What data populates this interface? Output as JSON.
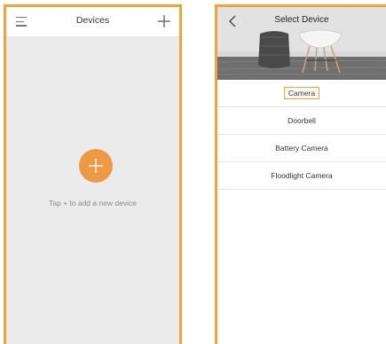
{
  "left_screen": {
    "title": "Devices",
    "empty_hint": "Tap + to add a new device"
  },
  "right_screen": {
    "title": "Select Device",
    "device_types": [
      {
        "label": "Camera",
        "selected": true
      },
      {
        "label": "Doorbell",
        "selected": false
      },
      {
        "label": "Battery Camera",
        "selected": false
      },
      {
        "label": "Floodlight Camera",
        "selected": false
      }
    ]
  },
  "colors": {
    "frame_border": "#f2a23a",
    "accent": "#ee9a45",
    "background_gray": "#ebebeb"
  },
  "icons": {
    "menu": "menu-icon",
    "add": "plus-icon",
    "add_device": "add-device-icon",
    "back": "back-arrow-icon"
  }
}
